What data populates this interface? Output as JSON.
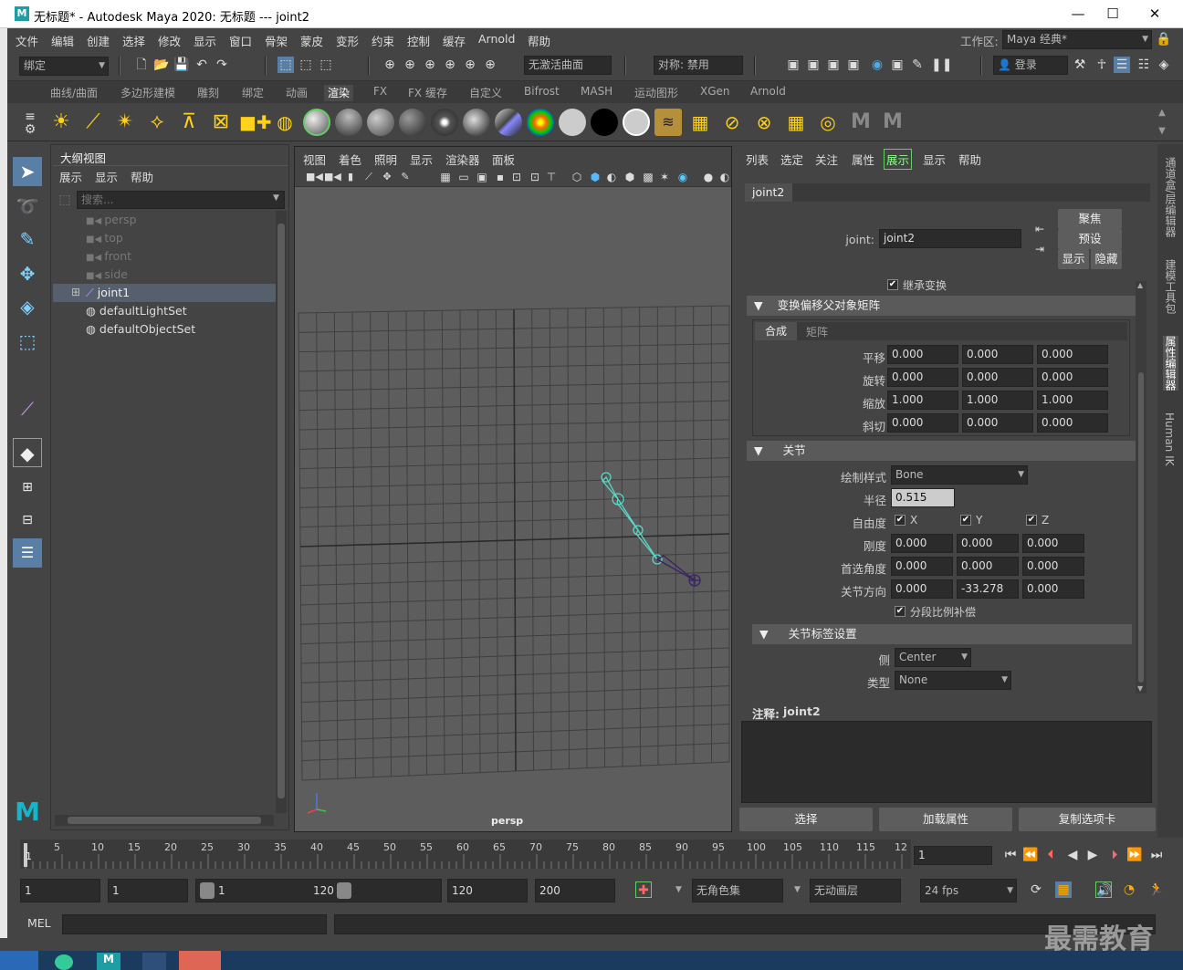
{
  "window": {
    "title": "无标题* - Autodesk Maya 2020: 无标题   ---   joint2",
    "logo": "M",
    "minimize": "—",
    "maximize": "☐",
    "close": "✕"
  },
  "menubar": {
    "items": [
      "文件",
      "编辑",
      "创建",
      "选择",
      "修改",
      "显示",
      "窗口",
      "骨架",
      "蒙皮",
      "变形",
      "约束",
      "控制",
      "缓存",
      "Arnold",
      "帮助"
    ],
    "workspace_label": "工作区:",
    "workspace_value": "Maya 经典*"
  },
  "statusline": {
    "mode": "绑定",
    "live_surface": "无激活曲面",
    "symmetry": "对称: 禁用",
    "login": "登录"
  },
  "shelf": {
    "tabs": [
      "曲线/曲面",
      "多边形建模",
      "雕刻",
      "绑定",
      "动画",
      "渲染",
      "FX",
      "FX 缓存",
      "自定义",
      "Bifrost",
      "MASH",
      "运动图形",
      "XGen",
      "Arnold"
    ],
    "active_tab": "渲染"
  },
  "outliner": {
    "title": "大纲视图",
    "menu": [
      "展示",
      "显示",
      "帮助"
    ],
    "search_placeholder": "搜索...",
    "items": [
      "persp",
      "top",
      "front",
      "side",
      "joint1",
      "defaultLightSet",
      "defaultObjectSet"
    ],
    "expand": "⊞"
  },
  "viewport": {
    "menu": [
      "视图",
      "着色",
      "照明",
      "显示",
      "渲染器",
      "面板"
    ],
    "camera_label": "persp"
  },
  "attr": {
    "menu": [
      "列表",
      "选定",
      "关注",
      "属性",
      "展示",
      "显示",
      "帮助"
    ],
    "tab": "joint2",
    "node_label": "joint:",
    "node_value": "joint2",
    "btn_focus": "聚焦",
    "btn_preset": "预设",
    "btn_show": "显示",
    "btn_hide": "隐藏",
    "inherit": "继承变换",
    "sect_offset": "变换偏移父对象矩阵",
    "subtabs": [
      "合成",
      "矩阵"
    ],
    "rows": [
      {
        "label": "平移",
        "v": [
          "0.000",
          "0.000",
          "0.000"
        ]
      },
      {
        "label": "旋转",
        "v": [
          "0.000",
          "0.000",
          "0.000"
        ]
      },
      {
        "label": "缩放",
        "v": [
          "1.000",
          "1.000",
          "1.000"
        ]
      },
      {
        "label": "斜切",
        "v": [
          "0.000",
          "0.000",
          "0.000"
        ]
      }
    ],
    "sect_joint": "关节",
    "draw_style_label": "绘制样式",
    "draw_style": "Bone",
    "radius_label": "半径",
    "radius": "0.515",
    "dof_label": "自由度",
    "dof": [
      "X",
      "Y",
      "Z"
    ],
    "stiff_label": "刚度",
    "stiff": [
      "0.000",
      "0.000",
      "0.000"
    ],
    "pref_label": "首选角度",
    "pref": [
      "0.000",
      "0.000",
      "0.000"
    ],
    "orient_label": "关节方向",
    "orient": [
      "0.000",
      "-33.278",
      "0.000"
    ],
    "seg_comp": "分段比例补偿",
    "sect_label": "关节标签设置",
    "side_label": "侧",
    "side": "Center",
    "type_label": "类型",
    "type": "None",
    "notes_label": "注释:",
    "notes_value": "joint2",
    "btn_select": "选择",
    "btn_load": "加载属性",
    "btn_copy": "复制选项卡"
  },
  "right_tabs": [
    "通道盒/层编辑器",
    "建模工具包",
    "属性编辑器",
    "Human IK"
  ],
  "timeline": {
    "ticks": [
      "1",
      "5",
      "10",
      "15",
      "20",
      "25",
      "30",
      "35",
      "40",
      "45",
      "50",
      "55",
      "60",
      "65",
      "70",
      "75",
      "80",
      "85",
      "90",
      "95",
      "100",
      "105",
      "110",
      "115",
      "12"
    ],
    "current": "1"
  },
  "range": {
    "start": "1",
    "inner_start": "1",
    "slider_start": "1",
    "slider_end": "120",
    "end": "120",
    "anim_end": "200",
    "charset": "无角色集",
    "layer": "无动画层",
    "fps": "24 fps"
  },
  "cmd": {
    "lang": "MEL"
  },
  "watermark": "最需教育"
}
